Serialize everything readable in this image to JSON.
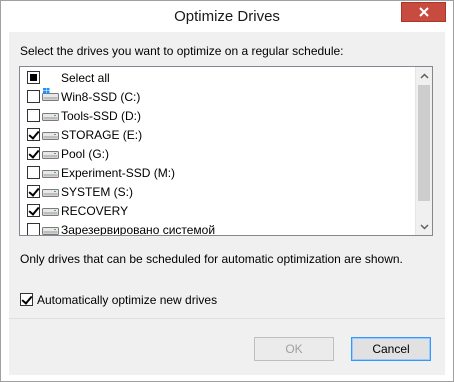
{
  "window": {
    "title": "Optimize Drives"
  },
  "instruction": "Select the drives you want to optimize on a regular schedule:",
  "drives": [
    {
      "label": "Select all",
      "state": "indeterminate",
      "icon": "none"
    },
    {
      "label": "Win8-SSD (C:)",
      "state": "unchecked",
      "icon": "windows-drive-icon"
    },
    {
      "label": "Tools-SSD (D:)",
      "state": "unchecked",
      "icon": "drive-icon"
    },
    {
      "label": "STORAGE (E:)",
      "state": "checked",
      "icon": "drive-icon"
    },
    {
      "label": "Pool (G:)",
      "state": "checked",
      "icon": "drive-icon"
    },
    {
      "label": "Experiment-SSD (M:)",
      "state": "unchecked",
      "icon": "drive-icon"
    },
    {
      "label": "SYSTEM (S:)",
      "state": "checked",
      "icon": "drive-icon"
    },
    {
      "label": "RECOVERY",
      "state": "checked",
      "icon": "drive-icon"
    },
    {
      "label": "Зарезервировано системой",
      "state": "unchecked",
      "icon": "drive-icon"
    }
  ],
  "note": "Only drives that can be scheduled for automatic optimization are shown.",
  "auto_optimize": {
    "label": "Automatically optimize new drives",
    "checked": true
  },
  "buttons": {
    "ok": "OK",
    "cancel": "Cancel"
  },
  "colors": {
    "close_button": "#c74b3f",
    "accent": "#3399ff"
  }
}
